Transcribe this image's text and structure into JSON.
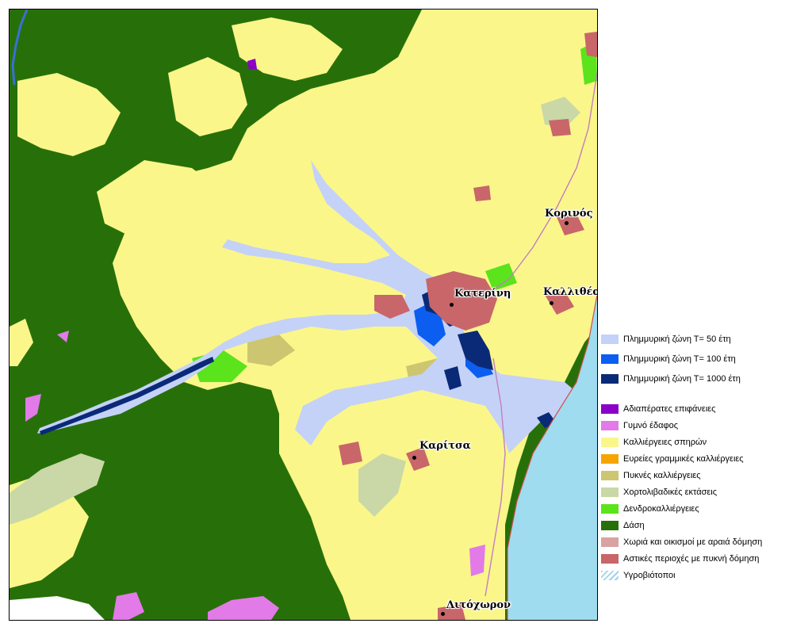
{
  "map": {
    "towns": [
      {
        "label": "Κορινός"
      },
      {
        "label": "Κατερίνη"
      },
      {
        "label": "Καλλιθέα"
      },
      {
        "label": "Καρίτσα"
      },
      {
        "label": "Λιτόχωρον"
      }
    ]
  },
  "legend": {
    "flood": [
      {
        "label": "Πλημμυρική ζώνη Τ= 50 έτη",
        "color": "#c4d2f7"
      },
      {
        "label": "Πλημμυρική ζώνη Τ= 100 έτη",
        "color": "#0b5ef0"
      },
      {
        "label": "Πλημμυρική ζώνη Τ= 1000 έτη",
        "color": "#0a2a78"
      }
    ],
    "landuse": [
      {
        "label": "Αδιαπέρατες επιφάνειες",
        "color": "#8a00c8"
      },
      {
        "label": "Γυμνό έδαφος",
        "color": "#e27ae8"
      },
      {
        "label": "Καλλιέργειες σπηρών",
        "color": "#fbf68a"
      },
      {
        "label": "Ευρείες γραμμικές καλλιέργειες",
        "color": "#f5a500"
      },
      {
        "label": "Πυκνές καλλιέργειες",
        "color": "#cdc670"
      },
      {
        "label": "Χορτολιβαδικές εκτάσεις",
        "color": "#c9d8a6"
      },
      {
        "label": "Δενδροκαλλιέργειες",
        "color": "#5be31c"
      },
      {
        "label": "Δάση",
        "color": "#277009"
      },
      {
        "label": "Χωριά και οικισμοί με αραιά δόμηση",
        "color": "#d9a3a3"
      },
      {
        "label": "Αστικές περιοχές με πυκνή δόμηση",
        "color": "#c8666a"
      },
      {
        "label": "Υγροβιότοποι",
        "color": "#9fd3e8"
      }
    ]
  }
}
